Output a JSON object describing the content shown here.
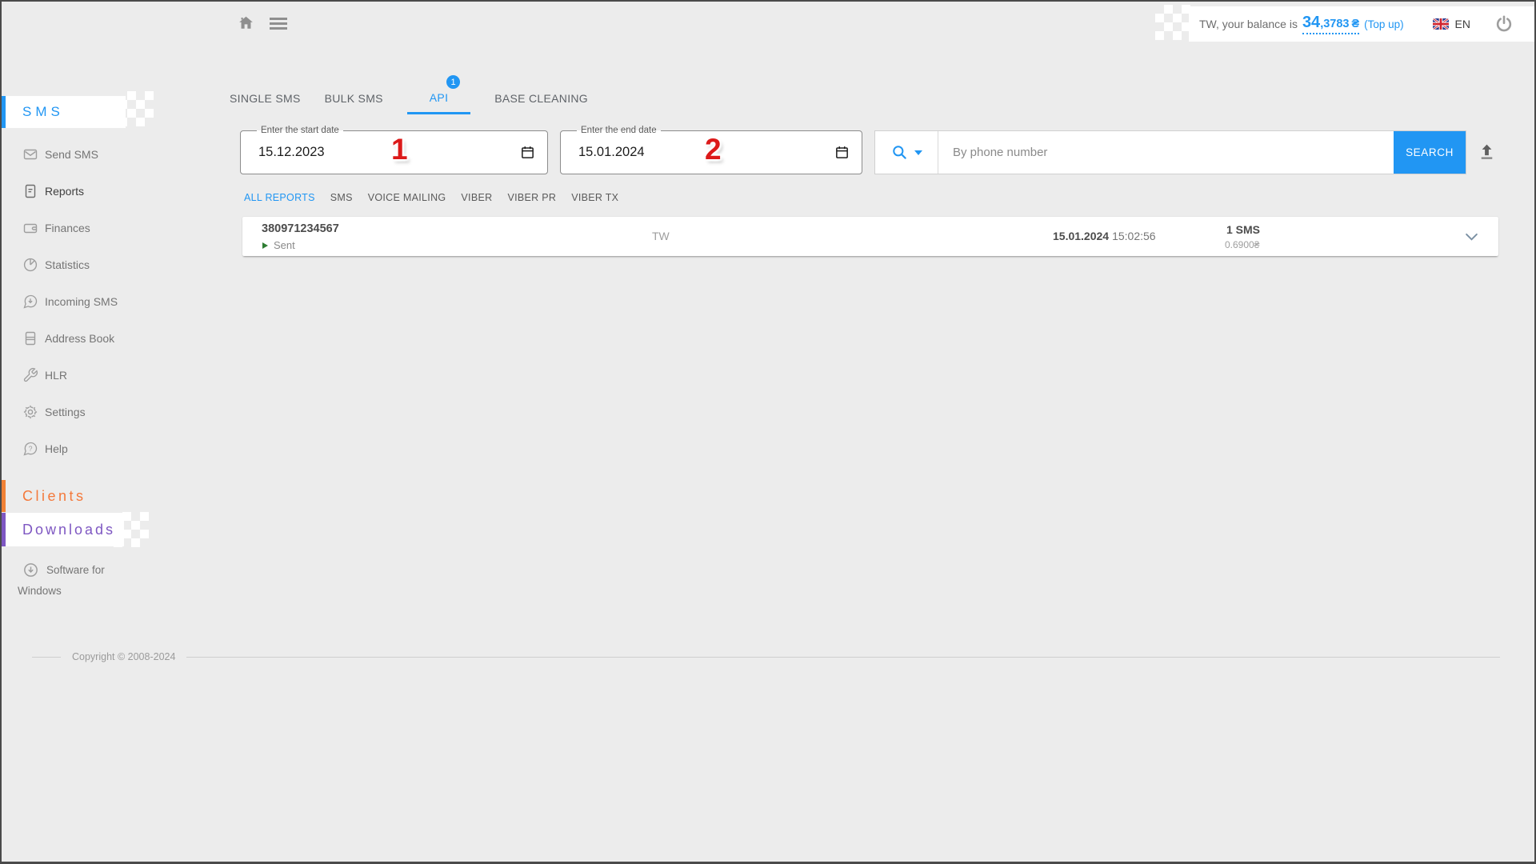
{
  "topbar": {
    "balance_prefix": "TW, your balance is",
    "balance_int": "34",
    "balance_frac": ",3783",
    "balance_currency": "₴",
    "topup": "(Top up)",
    "language": "EN"
  },
  "sidebar": {
    "section_sms": "SMS",
    "items": [
      {
        "label": "Send SMS",
        "icon": "envelope-icon"
      },
      {
        "label": "Reports",
        "icon": "document-icon",
        "active": true
      },
      {
        "label": "Finances",
        "icon": "wallet-icon"
      },
      {
        "label": "Statistics",
        "icon": "pie-chart-icon"
      },
      {
        "label": "Incoming SMS",
        "icon": "message-download-icon"
      },
      {
        "label": "Address Book",
        "icon": "book-icon"
      },
      {
        "label": "HLR",
        "icon": "wrench-icon"
      },
      {
        "label": "Settings",
        "icon": "gear-icon"
      },
      {
        "label": "Help",
        "icon": "question-bubble-icon"
      }
    ],
    "section_clients": "Clients",
    "section_downloads": "Downloads",
    "software_line1": "Software for",
    "software_line2": "Windows",
    "copyright": "Copyright © 2008-2024"
  },
  "tabs": [
    {
      "label": "SINGLE SMS"
    },
    {
      "label": "BULK SMS"
    },
    {
      "label": "API",
      "badge": "1",
      "active": true
    },
    {
      "label": "BASE CLEANING"
    }
  ],
  "filter_bar": {
    "start_date": {
      "label": "Enter the start date",
      "value": "15.12.2023",
      "annotation": "1"
    },
    "end_date": {
      "label": "Enter the end date",
      "value": "15.01.2024",
      "annotation": "2"
    },
    "search": {
      "placeholder": "By phone number",
      "button_label": "SEARCH"
    }
  },
  "report_tabs": [
    {
      "label": "ALL REPORTS",
      "active": true
    },
    {
      "label": "SMS"
    },
    {
      "label": "VOICE MAILING"
    },
    {
      "label": "VIBER"
    },
    {
      "label": "VIBER PR"
    },
    {
      "label": "VIBER TX"
    }
  ],
  "reports": [
    {
      "phone": "380971234567",
      "status": "Sent",
      "sender": "TW",
      "date": "15.01.2024",
      "time": "15:02:56",
      "count": "1 SMS",
      "cost": "0.6900₴"
    }
  ],
  "colors": {
    "accent_blue": "#2196f3",
    "clients_orange": "#f4793b",
    "downloads_purple": "#7e57c2",
    "annotation_red": "#dc1a1a",
    "sent_green": "#2e7d32"
  }
}
